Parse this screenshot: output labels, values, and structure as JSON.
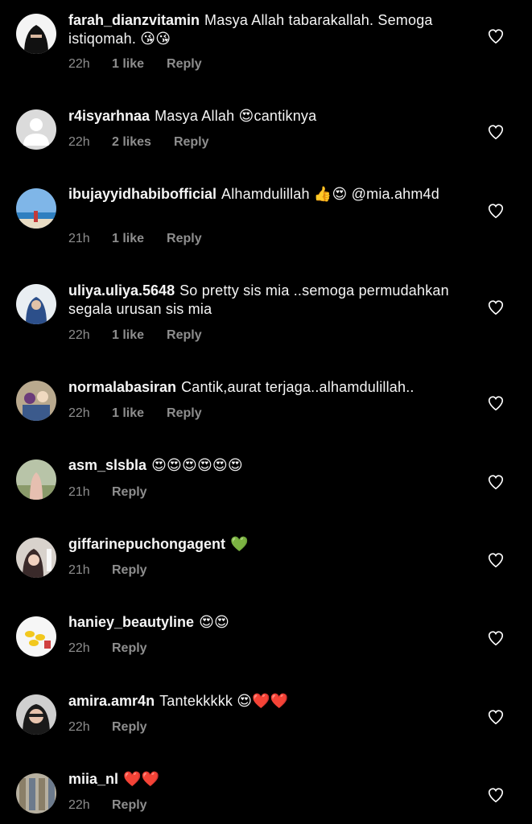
{
  "comments": [
    {
      "username": "farah_dianzvitamin",
      "text": "Masya Allah tabarakallah. Semoga istiqomah. 😘😘",
      "time": "22h",
      "likes": "1 like",
      "reply": "Reply",
      "avatar": "niqab-avatar"
    },
    {
      "username": "r4isyarhnaa",
      "text": "Masya Allah 😍cantiknya",
      "time": "22h",
      "likes": "2 likes",
      "reply": "Reply",
      "avatar": "default-avatar"
    },
    {
      "username": "ibujayyidhabibofficial",
      "text": "Alhamdulillah 👍😍 @mia.ahm4d",
      "time": "21h",
      "likes": "1 like",
      "reply": "Reply",
      "avatar": "beach-avatar"
    },
    {
      "username": "uliya.uliya.5648",
      "text": "So pretty sis mia ..semoga permudahkan segala urusan sis mia",
      "time": "22h",
      "likes": "1 like",
      "reply": "Reply",
      "avatar": "hijab-avatar"
    },
    {
      "username": "normalabasiran",
      "text": "Cantik,aurat terjaga..alhamdulillah..",
      "time": "22h",
      "likes": "1 like",
      "reply": "Reply",
      "avatar": "family-avatar"
    },
    {
      "username": "asm_slsbla",
      "text": "😍😍😍😍😍😍",
      "time": "21h",
      "likes": "",
      "reply": "Reply",
      "avatar": "field-avatar"
    },
    {
      "username": "giffarinepuchongagent",
      "text": "💚",
      "time": "21h",
      "likes": "",
      "reply": "Reply",
      "avatar": "product-avatar"
    },
    {
      "username": "haniey_beautyline",
      "text": "😍😍",
      "time": "22h",
      "likes": "",
      "reply": "Reply",
      "avatar": "capsule-avatar"
    },
    {
      "username": "amira.amr4n",
      "text": "Tantekkkkk 😍❤️❤️",
      "time": "22h",
      "likes": "",
      "reply": "Reply",
      "avatar": "glasses-avatar"
    },
    {
      "username": "miia_nl",
      "text": "❤️❤️",
      "time": "22h",
      "likes": "",
      "reply": "Reply",
      "avatar": "building-avatar"
    }
  ],
  "like_icon": "heart-outline-icon",
  "colors": {
    "background": "#000000",
    "text": "#ffffff",
    "meta": "#8e8e8e"
  }
}
